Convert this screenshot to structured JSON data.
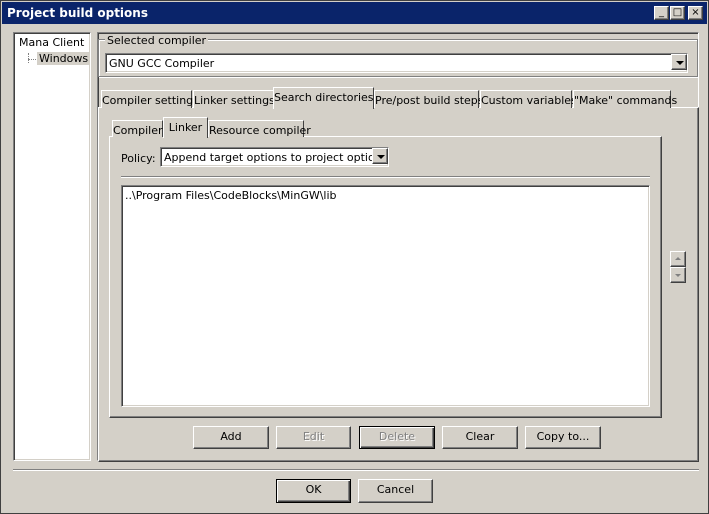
{
  "window": {
    "title": "Project build options",
    "minimize_glyph": "_",
    "maximize_glyph": "□",
    "close_glyph": "×"
  },
  "tree": {
    "items": [
      {
        "label": "Mana Client"
      },
      {
        "label": "Windows",
        "selected": true
      }
    ]
  },
  "compiler": {
    "group_label": "Selected compiler",
    "selected": "GNU GCC Compiler"
  },
  "tabs": [
    {
      "label": "Compiler settings"
    },
    {
      "label": "Linker settings"
    },
    {
      "label": "Search directories",
      "active": true
    },
    {
      "label": "Pre/post build steps"
    },
    {
      "label": "Custom variables"
    },
    {
      "label": "\"Make\" commands"
    }
  ],
  "subtabs": [
    {
      "label": "Compiler"
    },
    {
      "label": "Linker",
      "active": true
    },
    {
      "label": "Resource compiler"
    }
  ],
  "policy": {
    "label": "Policy:",
    "selected": "Append target options to project options"
  },
  "directories": [
    "..\\Program Files\\CodeBlocks\\MinGW\\lib"
  ],
  "actions": {
    "add": "Add",
    "edit": "Edit",
    "delete": "Delete",
    "clear": "Clear",
    "copy_to": "Copy to..."
  },
  "footer": {
    "ok": "OK",
    "cancel": "Cancel"
  },
  "colors": {
    "titlebar": "#0a246a",
    "face": "#d4d0c8",
    "disabled_text": "#808080"
  }
}
